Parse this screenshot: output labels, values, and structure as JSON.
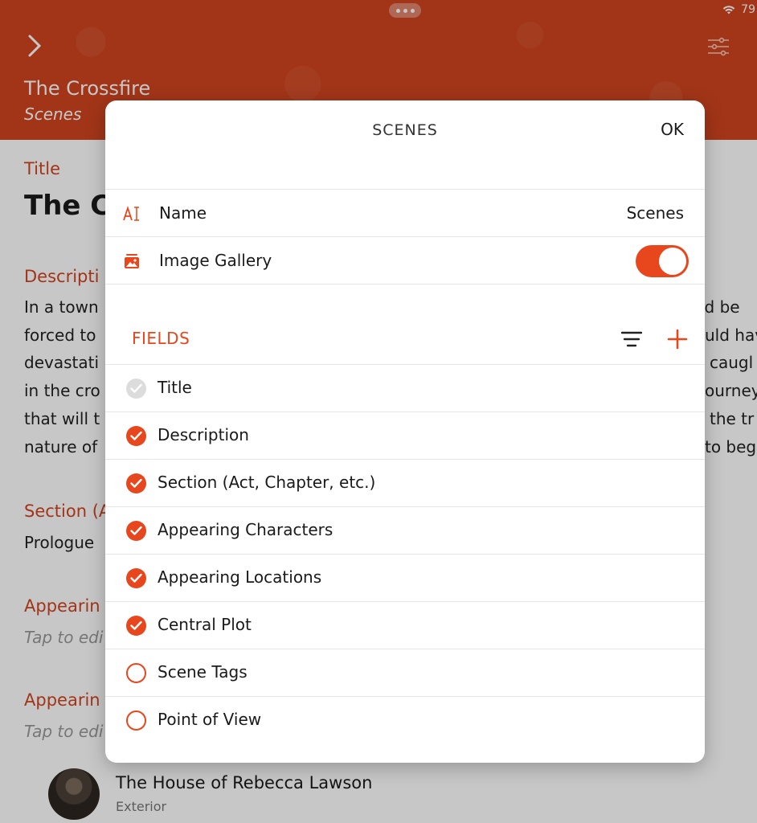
{
  "status_bar": {
    "battery": "79"
  },
  "header": {
    "title": "The Crossfire",
    "subtitle": "Scenes"
  },
  "background": {
    "title_label": "Title",
    "title_value": "The C",
    "description_label": "Descripti",
    "description_lines_left": [
      "In a town",
      "forced to",
      "devastati",
      "in the cro",
      "that will t",
      "nature of"
    ],
    "description_lines_right": [
      "ld be",
      "uld hav",
      "caugl",
      "ourney",
      "the tr",
      "to beg"
    ],
    "section_label": "Section (A",
    "section_value": "Prologue",
    "appearing_label_1": "Appearin",
    "appearing_hint_1": "Tap to edi",
    "appearing_label_2": "Appearin",
    "appearing_hint_2": "Tap to edi",
    "location": {
      "name": "The House of Rebecca Lawson",
      "type": "Exterior"
    }
  },
  "modal": {
    "title": "SCENES",
    "ok_label": "OK",
    "name_row": {
      "label": "Name",
      "value": "Scenes",
      "icon": "text-cursor-icon"
    },
    "gallery_row": {
      "label": "Image Gallery",
      "icon": "image-gallery-icon",
      "enabled": true
    },
    "fields_title": "FIELDS",
    "fields": [
      {
        "label": "Title",
        "state": "disabled"
      },
      {
        "label": "Description",
        "state": "on"
      },
      {
        "label": "Section (Act, Chapter, etc.)",
        "state": "on"
      },
      {
        "label": "Appearing Characters",
        "state": "on"
      },
      {
        "label": "Appearing Locations",
        "state": "on"
      },
      {
        "label": "Central Plot",
        "state": "on"
      },
      {
        "label": "Scene Tags",
        "state": "off"
      },
      {
        "label": "Point of View",
        "state": "off"
      }
    ]
  },
  "colors": {
    "accent": "#e8461c",
    "header": "#d0451f"
  }
}
